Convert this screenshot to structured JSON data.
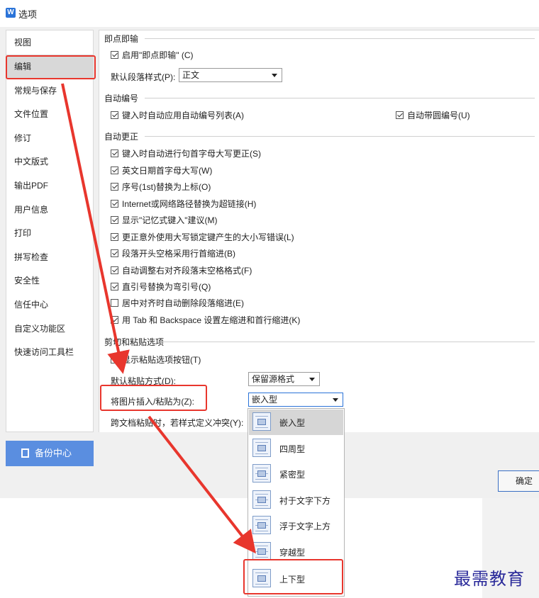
{
  "window": {
    "title": "选项",
    "app_icon": "wps-writer-icon"
  },
  "nav": {
    "items": [
      {
        "label": "视图"
      },
      {
        "label": "编辑",
        "selected": true
      },
      {
        "label": "常规与保存"
      },
      {
        "label": "文件位置"
      },
      {
        "label": "修订"
      },
      {
        "label": "中文版式"
      },
      {
        "label": "输出PDF"
      },
      {
        "label": "用户信息"
      },
      {
        "label": "打印"
      },
      {
        "label": "拼写检查"
      },
      {
        "label": "安全性"
      },
      {
        "label": "信任中心"
      },
      {
        "label": "自定义功能区"
      },
      {
        "label": "快速访问工具栏"
      }
    ],
    "backup_button": "备份中心"
  },
  "sections": {
    "instant_input": {
      "title": "即点即输",
      "enable": {
        "label": "启用\"即点即输\" (C)",
        "checked": true
      },
      "default_para_label": "默认段落样式(P):",
      "default_para_value": "正文"
    },
    "auto_numbering": {
      "title": "自动编号",
      "list": {
        "label": "键入时自动应用自动编号列表(A)",
        "checked": true
      },
      "circle": {
        "label": "自动带圆编号(U)",
        "checked": true
      }
    },
    "autocorrect": {
      "title": "自动更正",
      "options": [
        {
          "label": "键入时自动进行句首字母大写更正(S)",
          "checked": true
        },
        {
          "label": "英文日期首字母大写(W)",
          "checked": true
        },
        {
          "label": "序号(1st)替换为上标(O)",
          "checked": true
        },
        {
          "label": "Internet或网络路径替换为超链接(H)",
          "checked": true
        },
        {
          "label": "显示\"记忆式键入\"建议(M)",
          "checked": true
        },
        {
          "label": "更正意外使用大写锁定键产生的大小写错误(L)",
          "checked": true
        },
        {
          "label": "段落开头空格采用行首缩进(B)",
          "checked": true
        },
        {
          "label": "自动调整右对齐段落末空格格式(F)",
          "checked": true
        },
        {
          "label": "直引号替换为弯引号(Q)",
          "checked": true
        },
        {
          "label": "居中对齐时自动删除段落缩进(E)",
          "checked": false
        },
        {
          "label": "用 Tab 和 Backspace 设置左缩进和首行缩进(K)",
          "checked": true
        }
      ]
    },
    "paste": {
      "title": "剪切和粘贴选项",
      "show_btn": {
        "label": "显示粘贴选项按钮(T)",
        "checked": true
      },
      "default_paste_label": "默认粘贴方式(D):",
      "default_paste_value": "保留源格式",
      "insert_picture_label": "将图片插入/粘贴为(Z):",
      "insert_picture_value": "嵌入型",
      "cross_doc_label": "跨文档粘贴时，若样式定义冲突(Y):"
    }
  },
  "dropdown": {
    "items": [
      {
        "label": "嵌入型",
        "selected": true
      },
      {
        "label": "四周型"
      },
      {
        "label": "紧密型"
      },
      {
        "label": "衬于文字下方"
      },
      {
        "label": "浮于文字上方"
      },
      {
        "label": "穿越型"
      },
      {
        "label": "上下型",
        "highlighted": true
      }
    ]
  },
  "buttons": {
    "ok": "确定"
  },
  "watermark": "最需教育",
  "colors": {
    "accent": "#2a73d8",
    "annotation": "#e8362d",
    "backup": "#5a8ee0"
  }
}
